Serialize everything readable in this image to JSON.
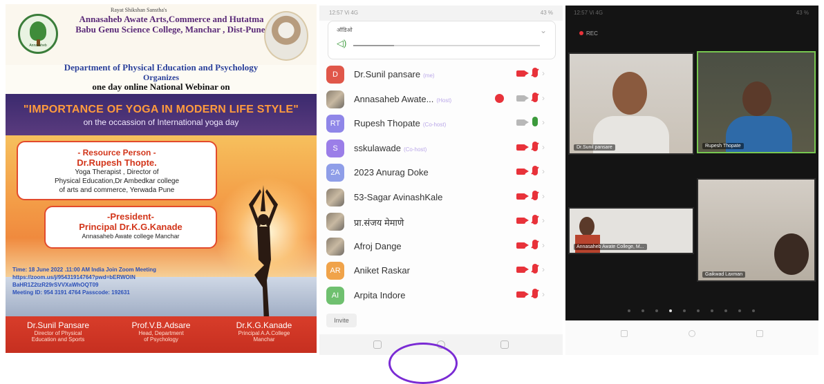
{
  "poster": {
    "trust": "Rayat Shikshan Sanstha's",
    "college": "Annasaheb Awate Arts,Commerce and Hutatma Babu Genu Science College, Manchar , Dist-Pune.",
    "logo_text": "Annasaheb",
    "department": "Department of Physical Education and Psychology",
    "organizes": "Organizes",
    "webinar_line": "one day online National Webinar on",
    "title": "\"IMPORTANCE OF YOGA IN MODERN LIFE STYLE\"",
    "subtitle": "on the occassion of International yoga day",
    "resource_heading": "- Resource Person -",
    "resource_name": "Dr.Rupesh Thopte.",
    "resource_desc": [
      "Yoga Therapist , Director of",
      "Physical Education,Dr Ambedkar college",
      "of arts and commerce, Yerwada Pune"
    ],
    "president_heading": "-President-",
    "president_name": "Principal Dr.K.G.Kanade",
    "president_desc": "Annasaheb Awate college Manchar",
    "zoom_lines": [
      "Time: 18 June 2022 .11:00 AM India Join Zoom Meeting",
      "https://zoom.us/j/95431914764?pwd=bERWOlN",
      "BaHR1Z2tzR29rSVVXaWhOQT09",
      "Meeting ID: 954 3191 4764 Passcode: 192631"
    ],
    "footer": [
      {
        "name": "Dr.Sunil Pansare",
        "role": [
          "Director of Physical",
          "Education and Sports"
        ]
      },
      {
        "name": "Prof.V.B.Adsare",
        "role": [
          "Head, Department",
          "of Psychology"
        ]
      },
      {
        "name": "Dr.K.G.Kanade",
        "role": [
          "Principal A.A.College",
          "Manchar"
        ]
      }
    ]
  },
  "phone": {
    "status_left": "12:57 Vi 4G",
    "status_right": "43 %",
    "audio_label": "ऑडिओ",
    "participants": [
      {
        "initials": "D",
        "color": "#e0574a",
        "name": "Dr.Sunil pansare",
        "tag": "(me)",
        "rec": false,
        "video": "off-red",
        "mic": "muted"
      },
      {
        "initials": "",
        "color": "",
        "photo": true,
        "name": "Annasaheb Awate...",
        "tag": "(Host)",
        "rec": true,
        "video": "off-grey",
        "mic": "muted"
      },
      {
        "initials": "RT",
        "color": "#8f86e8",
        "name": "Rupesh Thopate",
        "tag": "(Co-host)",
        "rec": false,
        "video": "off-grey",
        "mic": "on"
      },
      {
        "initials": "S",
        "color": "#9b7ee8",
        "name": "sskulawade",
        "tag": "(Co-host)",
        "rec": false,
        "video": "off-red",
        "mic": "muted"
      },
      {
        "initials": "2A",
        "color": "#8f9ee8",
        "name": "2023 Anurag Doke",
        "tag": "",
        "rec": false,
        "video": "off-red",
        "mic": "muted"
      },
      {
        "initials": "",
        "color": "",
        "photo": true,
        "name": "53-Sagar AvinashKale",
        "tag": "",
        "rec": false,
        "video": "off-red",
        "mic": "muted"
      },
      {
        "initials": "",
        "color": "",
        "photo": true,
        "name": "प्रा.संजय मेमाणे",
        "tag": "",
        "rec": false,
        "video": "off-red",
        "mic": "muted"
      },
      {
        "initials": "",
        "color": "",
        "photo": true,
        "name": "Afroj Dange",
        "tag": "",
        "rec": false,
        "video": "off-red",
        "mic": "muted"
      },
      {
        "initials": "AR",
        "color": "#f0a34a",
        "name": "Aniket Raskar",
        "tag": "",
        "rec": false,
        "video": "off-red",
        "mic": "muted"
      },
      {
        "initials": "AI",
        "color": "#6fc06f",
        "name": "Arpita Indore",
        "tag": "",
        "rec": false,
        "video": "off-red",
        "mic": "muted"
      }
    ],
    "invite": "Invite"
  },
  "gallery": {
    "status_left": "12:57 Vi 4G",
    "status_right": "43 %",
    "rec": "REC",
    "tiles": [
      {
        "label": "Dr.Sunil pansare"
      },
      {
        "label": "Rupesh Thopate"
      },
      {
        "label": "Annasaheb Awate College, M..."
      },
      {
        "label": "Gaikwad Laxman"
      }
    ]
  },
  "colors": {
    "poster_red": "#d2351a",
    "zoom_red": "#e8323a",
    "active_green": "#78c850"
  }
}
